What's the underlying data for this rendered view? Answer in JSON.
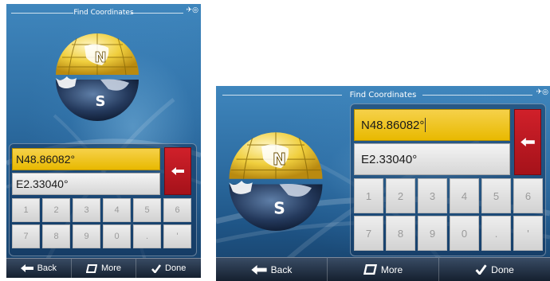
{
  "title": "Find Coordinates",
  "status_icon": "gps-satellite-icon",
  "globe": {
    "north_label": "N",
    "south_label": "S"
  },
  "latitude_value": "N48.86082°",
  "longitude_value": "E2.33040°",
  "keypad": [
    [
      "1",
      "2",
      "3",
      "4",
      "5",
      "6"
    ],
    [
      "7",
      "8",
      "9",
      "0",
      ".",
      "'"
    ]
  ],
  "bottom_bar": {
    "back_label": "Back",
    "more_label": "More",
    "done_label": "Done"
  },
  "colors": {
    "active_field": "#e8b900",
    "backspace": "#c01a22",
    "background": "#2e6ea3"
  }
}
